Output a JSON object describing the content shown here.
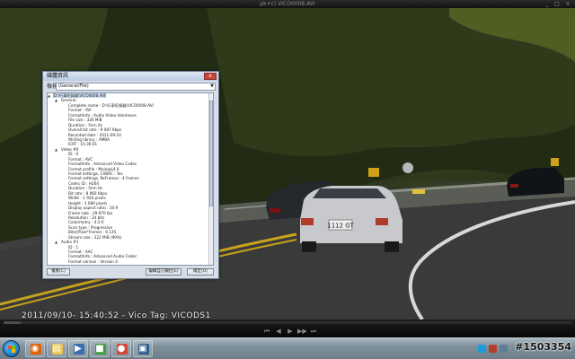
{
  "player": {
    "title": "pk+c) VICO0008.AVI",
    "osd_text": "2011/09/10- 15:40:52 - Vico Tag: VICODS1",
    "progress": 0.03,
    "controls": [
      "prev-icon",
      "rewind-icon",
      "play-icon",
      "forward-icon",
      "next-icon"
    ]
  },
  "video": {
    "plate": "1112 GT"
  },
  "dialog": {
    "title": "媒體資訊",
    "close_label": "x",
    "view_label": "檢視",
    "view_value": "(General/File)",
    "tree": [
      {
        "depth": 0,
        "twisty": "▲",
        "text": "D:\\行車紀錄器\\VICO0008.AVI",
        "selected": true
      },
      {
        "depth": 1,
        "twisty": "▲",
        "text": "General"
      },
      {
        "depth": 2,
        "twisty": "",
        "text": "Complete name : D:\\行車紀錄器\\VICO0008.AVI"
      },
      {
        "depth": 2,
        "twisty": "",
        "text": "Format : AVI"
      },
      {
        "depth": 2,
        "twisty": "",
        "text": "Format/Info : Audio Video Interleave"
      },
      {
        "depth": 2,
        "twisty": "",
        "text": "File size : 326 MiB"
      },
      {
        "depth": 2,
        "twisty": "",
        "text": "Duration : 5mn 0s"
      },
      {
        "depth": 2,
        "twisty": "",
        "text": "Overall bit rate : 9 087 Kbps"
      },
      {
        "depth": 2,
        "twisty": "",
        "text": "Recorded date : 2011-09-10"
      },
      {
        "depth": 2,
        "twisty": "",
        "text": "Writing library : AMBA"
      },
      {
        "depth": 2,
        "twisty": "",
        "text": "ICRT : 15:36:01"
      },
      {
        "depth": 1,
        "twisty": "▲",
        "text": "Video #0"
      },
      {
        "depth": 2,
        "twisty": "",
        "text": "ID : 0"
      },
      {
        "depth": 2,
        "twisty": "",
        "text": "Format : AVC"
      },
      {
        "depth": 2,
        "twisty": "",
        "text": "Format/Info : Advanced Video Codec"
      },
      {
        "depth": 2,
        "twisty": "",
        "text": "Format profile : Main@L4.0"
      },
      {
        "depth": 2,
        "twisty": "",
        "text": "Format settings, CABAC : Yes"
      },
      {
        "depth": 2,
        "twisty": "",
        "text": "Format settings, ReFrames : 4 frames"
      },
      {
        "depth": 2,
        "twisty": "",
        "text": "Codec ID : H264"
      },
      {
        "depth": 2,
        "twisty": "",
        "text": "Duration : 5mn 0s"
      },
      {
        "depth": 2,
        "twisty": "",
        "text": "Bit rate : 8 960 Kbps"
      },
      {
        "depth": 2,
        "twisty": "",
        "text": "Width : 1 920 pixels"
      },
      {
        "depth": 2,
        "twisty": "",
        "text": "Height : 1 080 pixels"
      },
      {
        "depth": 2,
        "twisty": "",
        "text": "Display aspect ratio : 16:9"
      },
      {
        "depth": 2,
        "twisty": "",
        "text": "Frame rate : 29.970 fps"
      },
      {
        "depth": 2,
        "twisty": "",
        "text": "Resolution : 24 bits"
      },
      {
        "depth": 2,
        "twisty": "",
        "text": "Colorimetry : 4:2:0"
      },
      {
        "depth": 2,
        "twisty": "",
        "text": "Scan type : Progressive"
      },
      {
        "depth": 2,
        "twisty": "",
        "text": "Bits/(Pixel*Frame) : 0.145"
      },
      {
        "depth": 2,
        "twisty": "",
        "text": "Stream size : 322 MiB (99%)"
      },
      {
        "depth": 1,
        "twisty": "▲",
        "text": "Audio #1"
      },
      {
        "depth": 2,
        "twisty": "",
        "text": "ID : 1"
      },
      {
        "depth": 2,
        "twisty": "",
        "text": "Format : AAC"
      },
      {
        "depth": 2,
        "twisty": "",
        "text": "Format/Info : Advanced Audio Codec"
      },
      {
        "depth": 2,
        "twisty": "",
        "text": "Format version : Version 4"
      }
    ],
    "buttons": {
      "copy": "複製(C)",
      "edit": "編輯自訂欄位(E)",
      "ok": "確定(O)"
    }
  },
  "taskbar": {
    "apps": [
      {
        "name": "firefox",
        "icon": "firefox-icon",
        "color": "#e66000",
        "glyph": "◉"
      },
      {
        "name": "explorer",
        "icon": "folder-icon",
        "color": "#e8c65a",
        "glyph": "▤"
      },
      {
        "name": "media",
        "icon": "media-player-icon",
        "color": "#3a6fb0",
        "glyph": "▶"
      },
      {
        "name": "green-app",
        "icon": "green-app-icon",
        "color": "#3c9c3c",
        "glyph": "■"
      },
      {
        "name": "chrome",
        "icon": "chrome-icon",
        "color": "#d44638",
        "glyph": "●"
      },
      {
        "name": "display",
        "icon": "display-icon",
        "color": "#2c5d8f",
        "glyph": "▣"
      }
    ],
    "tray_icons": [
      "skype-icon",
      "tray-icon-2",
      "tray-icon-3"
    ],
    "watermark": "#1503354"
  },
  "colors": {
    "accent": "#cfe0f6",
    "close": "#c7453b"
  }
}
